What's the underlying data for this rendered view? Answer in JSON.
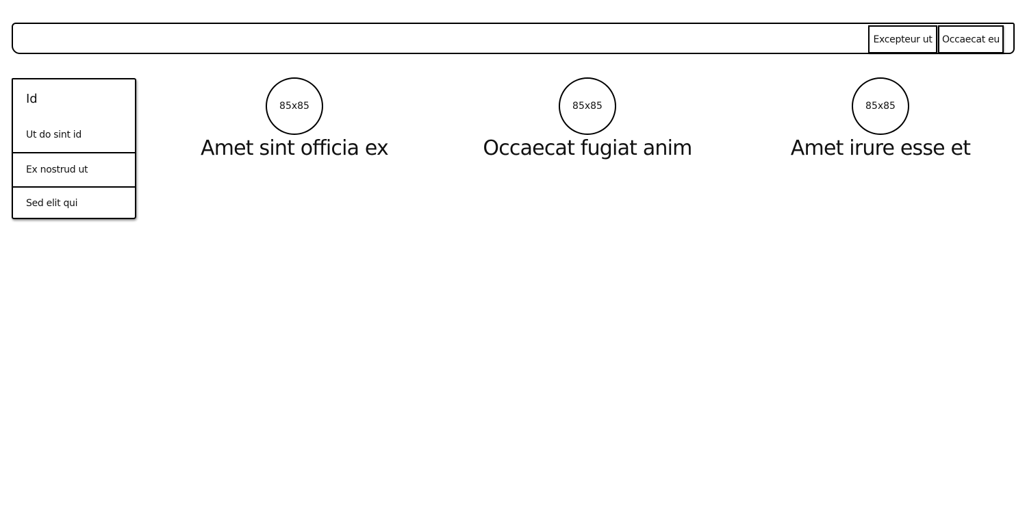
{
  "navbar": {
    "buttons": [
      "Excepteur ut",
      "Occaecat eu"
    ]
  },
  "sidebar": {
    "title": "Id",
    "items": [
      "Ut do sint id",
      "Ex nostrud ut",
      "Sed elit qui"
    ]
  },
  "features": [
    {
      "image_label": "85x85",
      "title": "Amet sint officia ex"
    },
    {
      "image_label": "85x85",
      "title": "Occaecat fugiat anim"
    },
    {
      "image_label": "85x85",
      "title": "Amet irure esse et"
    }
  ]
}
